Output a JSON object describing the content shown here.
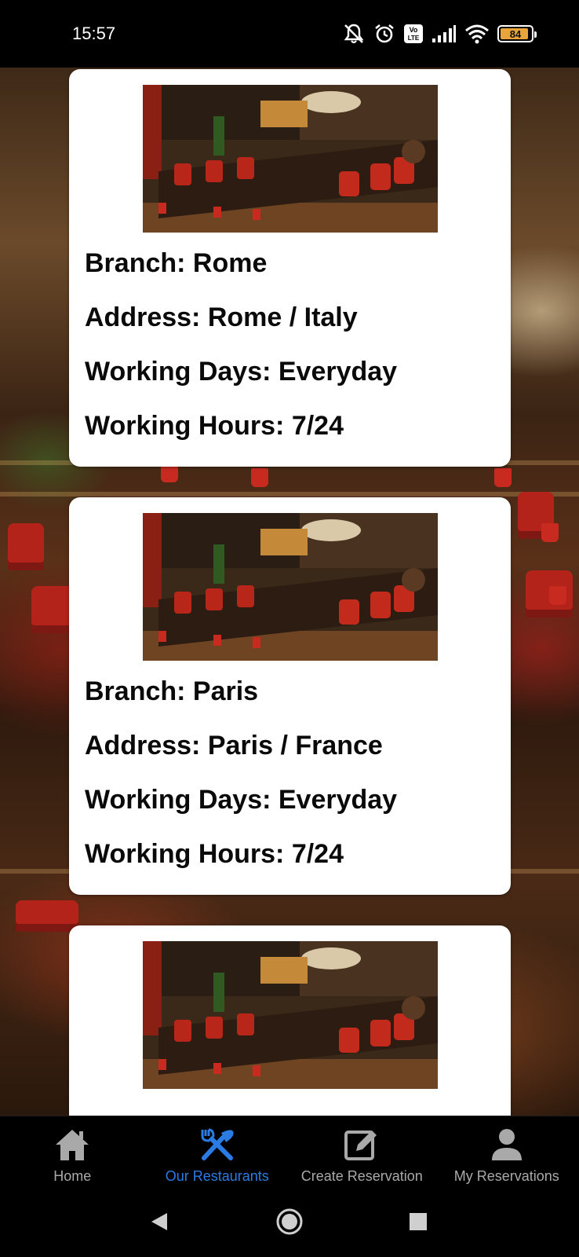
{
  "status_bar": {
    "time": "15:57",
    "battery_level": "84",
    "icons": [
      "mute-icon",
      "alarm-icon",
      "volte-icon",
      "signal-icon",
      "wifi-icon",
      "battery-icon"
    ]
  },
  "restaurants": [
    {
      "branch": "Branch: Rome",
      "address": "Address: Rome / Italy",
      "working_days": "Working Days: Everyday",
      "working_hours": "Working Hours: 7/24"
    },
    {
      "branch": "Branch: Paris",
      "address": "Address: Paris / France",
      "working_days": "Working Days: Everyday",
      "working_hours": "Working Hours: 7/24"
    }
  ],
  "bottom_nav": {
    "home": "Home",
    "our_restaurants": "Our Restaurants",
    "create_reservation": "Create Reservation",
    "my_reservations": "My Reservations",
    "active": "our_restaurants",
    "active_color": "#2b7be4",
    "inactive_color": "#a9a9a9"
  },
  "system_nav": [
    "back-icon",
    "home-circle-icon",
    "recents-icon"
  ]
}
